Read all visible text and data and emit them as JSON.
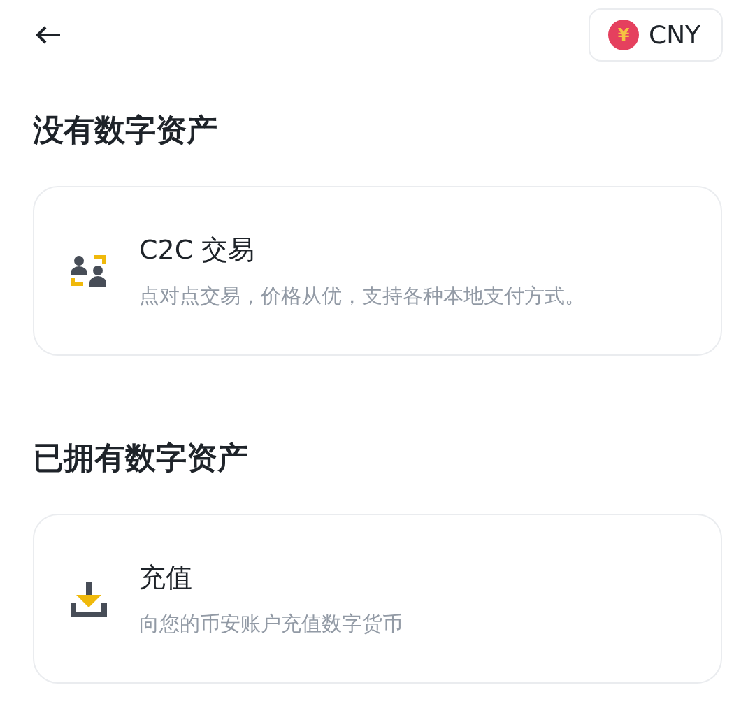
{
  "header": {
    "currency": {
      "symbol": "¥",
      "code": "CNY"
    }
  },
  "sections": [
    {
      "title": "没有数字资产",
      "cards": [
        {
          "kind": "c2c",
          "title": "C2C 交易",
          "description": "点对点交易，价格从优，支持各种本地支付方式。"
        }
      ]
    },
    {
      "title": "已拥有数字资产",
      "cards": [
        {
          "kind": "deposit",
          "title": "充值",
          "description": "向您的币安账户充值数字货币"
        }
      ]
    }
  ]
}
